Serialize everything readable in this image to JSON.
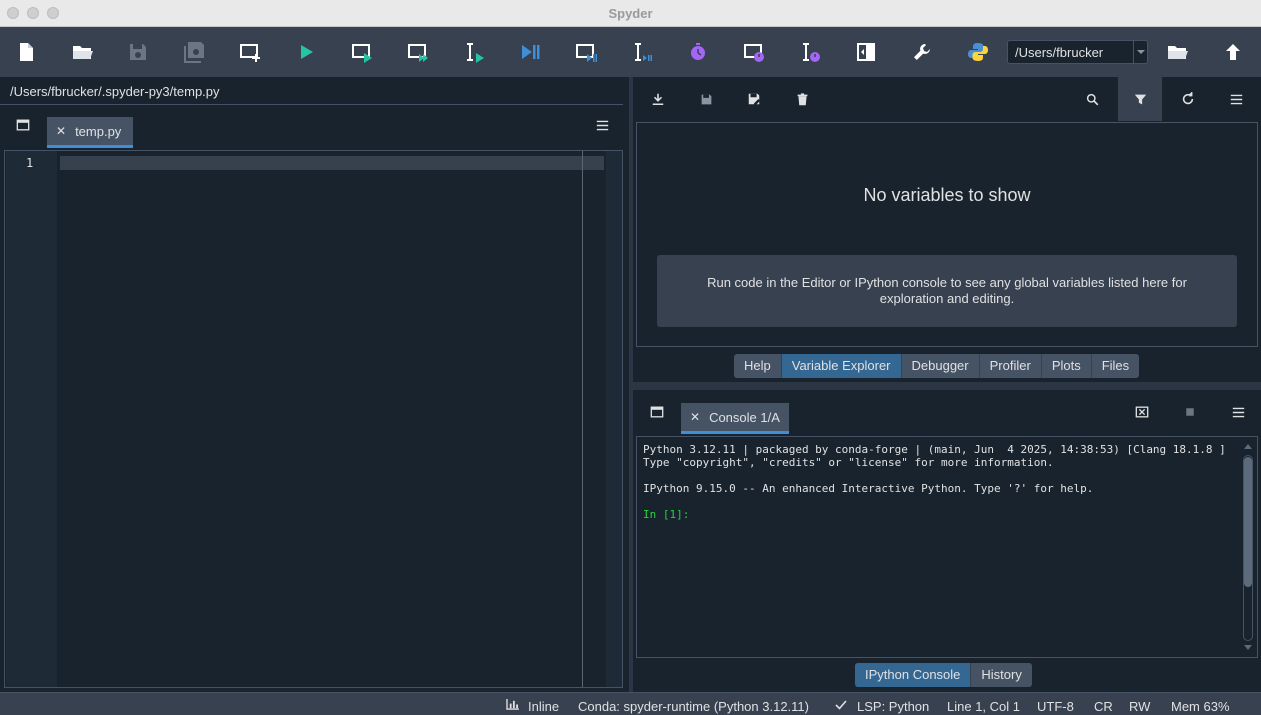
{
  "window": {
    "title": "Spyder"
  },
  "toolbar": {
    "buttons": [
      "new-file",
      "open-file",
      "save-file",
      "save-all",
      "new-cell",
      "run",
      "run-cell",
      "run-cell-advance",
      "run-selection",
      "debug",
      "debug-cell",
      "debug-selection",
      "profile",
      "profile-cell",
      "profile-selection",
      "maximize-pane",
      "preferences",
      "pythonpath-manager"
    ],
    "working_directory": "/Users/fbrucker"
  },
  "editor": {
    "file_path": "/Users/fbrucker/.spyder-py3/temp.py",
    "tab_label": "temp.py",
    "close_glyph": "✕",
    "line_numbers": [
      "1"
    ]
  },
  "variable_explorer": {
    "empty_title": "No variables to show",
    "empty_description": "Run code in the Editor or IPython console to see any global variables listed here for exploration and editing."
  },
  "top_tabs": [
    {
      "label": "Help",
      "active": false
    },
    {
      "label": "Variable Explorer",
      "active": true
    },
    {
      "label": "Debugger",
      "active": false
    },
    {
      "label": "Profiler",
      "active": false
    },
    {
      "label": "Plots",
      "active": false
    },
    {
      "label": "Files",
      "active": false
    }
  ],
  "console": {
    "tab_label": "Console 1/A",
    "close_glyph": "✕",
    "lines": [
      "Python 3.12.11 | packaged by conda-forge | (main, Jun  4 2025, 14:38:53) [Clang 18.1.8 ]",
      "Type \"copyright\", \"credits\" or \"license\" for more information.",
      "",
      "IPython 9.15.0 -- An enhanced Interactive Python. Type '?' for help.",
      "",
      "In [1]:"
    ]
  },
  "bottom_tabs": [
    {
      "label": "IPython Console",
      "active": true
    },
    {
      "label": "History",
      "active": false
    }
  ],
  "statusbar": {
    "inline": "Inline",
    "conda": "Conda: spyder-runtime (Python 3.12.11)",
    "lsp": "LSP: Python",
    "position": "Line 1, Col 1",
    "encoding": "UTF-8",
    "eol": "CR",
    "permissions": "RW",
    "memory": "Mem 63%"
  },
  "colors": {
    "background": "#19232d",
    "toolbar": "#37414f",
    "accent": "#3d8fd8",
    "active_tab": "#346792",
    "run_green": "#27c4a3",
    "profile_purple": "#a366f5",
    "prompt_green": "#22d43a"
  }
}
